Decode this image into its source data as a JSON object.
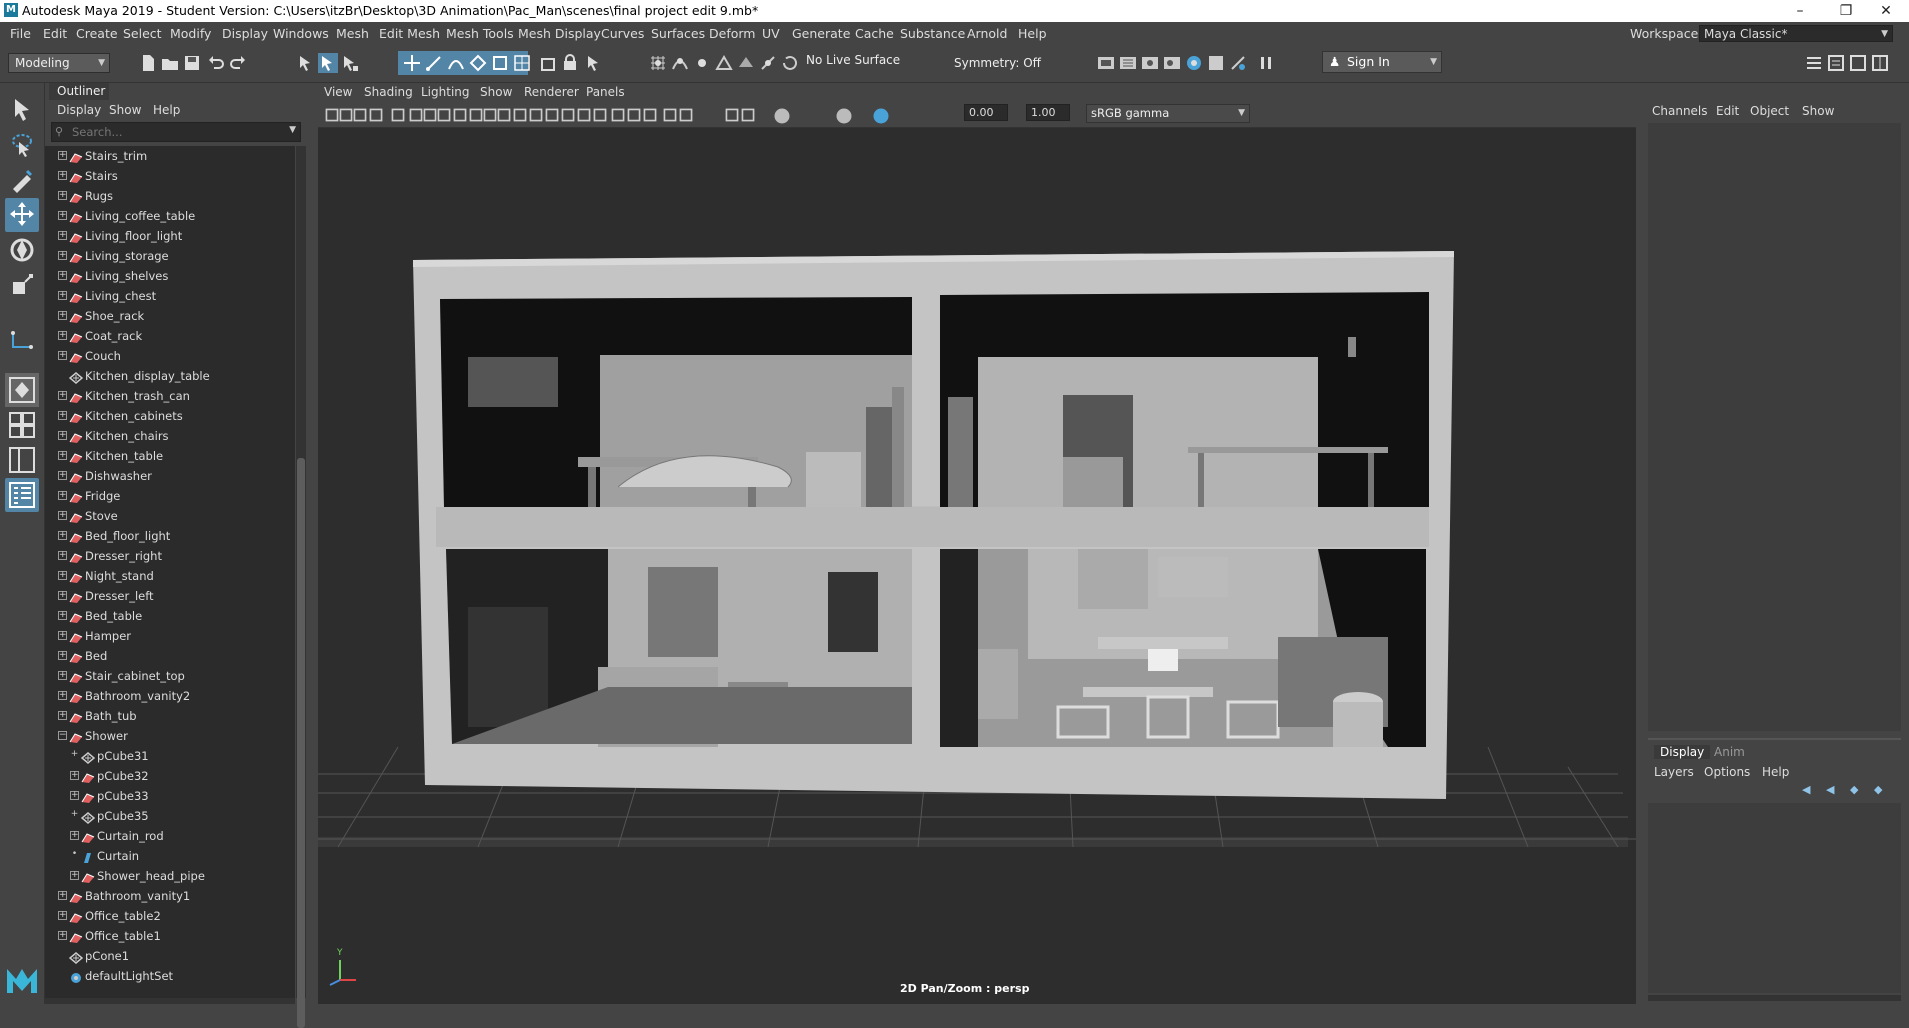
{
  "window": {
    "title": "Autodesk Maya 2019 - Student Version: C:\\Users\\itzBr\\Desktop\\3D Animation\\Pac_Man\\scenes\\final project edit 9.mb*"
  },
  "menubar": [
    "File",
    "Edit",
    "Create",
    "Select",
    "Modify",
    "Display",
    "Windows",
    "Mesh",
    "Edit Mesh",
    "Mesh Tools",
    "Mesh Display",
    "Curves",
    "Surfaces",
    "Deform",
    "UV",
    "Generate",
    "Cache",
    "Substance",
    "Arnold",
    "Help"
  ],
  "workspace": {
    "label": "Workspace :",
    "value": "Maya Classic*"
  },
  "statusline": {
    "mode": "Modeling",
    "live_surface": "No Live Surface",
    "symmetry": "Symmetry: Off",
    "sign_in": "Sign In"
  },
  "outliner": {
    "tab": "Outliner",
    "menu": [
      "Display",
      "Show",
      "Help"
    ],
    "search_placeholder": "Search...",
    "items": [
      {
        "label": "Stairs_trim",
        "depth": 0,
        "type": "mesh"
      },
      {
        "label": "Stairs",
        "depth": 0,
        "type": "mesh"
      },
      {
        "label": "Rugs",
        "depth": 0,
        "type": "mesh"
      },
      {
        "label": "Living_coffee_table",
        "depth": 0,
        "type": "mesh"
      },
      {
        "label": "Living_floor_light",
        "depth": 0,
        "type": "mesh"
      },
      {
        "label": "Living_storage",
        "depth": 0,
        "type": "mesh"
      },
      {
        "label": "Living_shelves",
        "depth": 0,
        "type": "mesh"
      },
      {
        "label": "Living_chest",
        "depth": 0,
        "type": "mesh"
      },
      {
        "label": "Shoe_rack",
        "depth": 0,
        "type": "mesh"
      },
      {
        "label": "Coat_rack",
        "depth": 0,
        "type": "mesh"
      },
      {
        "label": "Couch",
        "depth": 0,
        "type": "mesh"
      },
      {
        "label": "Kitchen_display_table",
        "depth": 0,
        "type": "transform"
      },
      {
        "label": "Kitchen_trash_can",
        "depth": 0,
        "type": "mesh"
      },
      {
        "label": "Kitchen_cabinets",
        "depth": 0,
        "type": "mesh"
      },
      {
        "label": "Kitchen_chairs",
        "depth": 0,
        "type": "mesh"
      },
      {
        "label": "Kitchen_table",
        "depth": 0,
        "type": "mesh"
      },
      {
        "label": "Dishwasher",
        "depth": 0,
        "type": "mesh"
      },
      {
        "label": "Fridge",
        "depth": 0,
        "type": "mesh"
      },
      {
        "label": "Stove",
        "depth": 0,
        "type": "mesh"
      },
      {
        "label": "Bed_floor_light",
        "depth": 0,
        "type": "mesh"
      },
      {
        "label": "Dresser_right",
        "depth": 0,
        "type": "mesh"
      },
      {
        "label": "Night_stand",
        "depth": 0,
        "type": "mesh"
      },
      {
        "label": "Dresser_left",
        "depth": 0,
        "type": "mesh"
      },
      {
        "label": "Bed_table",
        "depth": 0,
        "type": "mesh"
      },
      {
        "label": "Hamper",
        "depth": 0,
        "type": "mesh"
      },
      {
        "label": "Bed",
        "depth": 0,
        "type": "mesh"
      },
      {
        "label": "Stair_cabinet_top",
        "depth": 0,
        "type": "mesh"
      },
      {
        "label": "Bathroom_vanity2",
        "depth": 0,
        "type": "mesh"
      },
      {
        "label": "Bath_tub",
        "depth": 0,
        "type": "mesh"
      },
      {
        "label": "Shower",
        "depth": 0,
        "type": "mesh",
        "expanded": true
      },
      {
        "label": "pCube31",
        "depth": 1,
        "type": "transform"
      },
      {
        "label": "pCube32",
        "depth": 1,
        "type": "mesh"
      },
      {
        "label": "pCube33",
        "depth": 1,
        "type": "mesh"
      },
      {
        "label": "pCube35",
        "depth": 1,
        "type": "transform"
      },
      {
        "label": "Curtain_rod",
        "depth": 1,
        "type": "mesh"
      },
      {
        "label": "Curtain",
        "depth": 1,
        "type": "curtain"
      },
      {
        "label": "Shower_head_pipe",
        "depth": 1,
        "type": "mesh"
      },
      {
        "label": "Bathroom_vanity1",
        "depth": 0,
        "type": "mesh"
      },
      {
        "label": "Office_table2",
        "depth": 0,
        "type": "mesh"
      },
      {
        "label": "Office_table1",
        "depth": 0,
        "type": "mesh"
      },
      {
        "label": "pCone1",
        "depth": 0,
        "type": "transform"
      },
      {
        "label": "defaultLightSet",
        "depth": 0,
        "type": "set"
      }
    ]
  },
  "viewport": {
    "menu": [
      "View",
      "Shading",
      "Lighting",
      "Show",
      "Renderer",
      "Panels"
    ],
    "exposure": "0.00",
    "gamma": "1.00",
    "color_space": "sRGB gamma",
    "camera_label": "2D Pan/Zoom : persp",
    "axis_y": "Y"
  },
  "channelbox": {
    "menu": [
      "Channels",
      "Edit",
      "Object",
      "Show"
    ],
    "layer_tabs": [
      "Display",
      "Anim"
    ],
    "layer_menu": [
      "Layers",
      "Options",
      "Help"
    ]
  },
  "colors": {
    "accent": "#5285a6",
    "outliner_bg": "#2b2b2b",
    "viewport_bg": "#2d2d2d",
    "mesh_icon": "#e06060"
  }
}
